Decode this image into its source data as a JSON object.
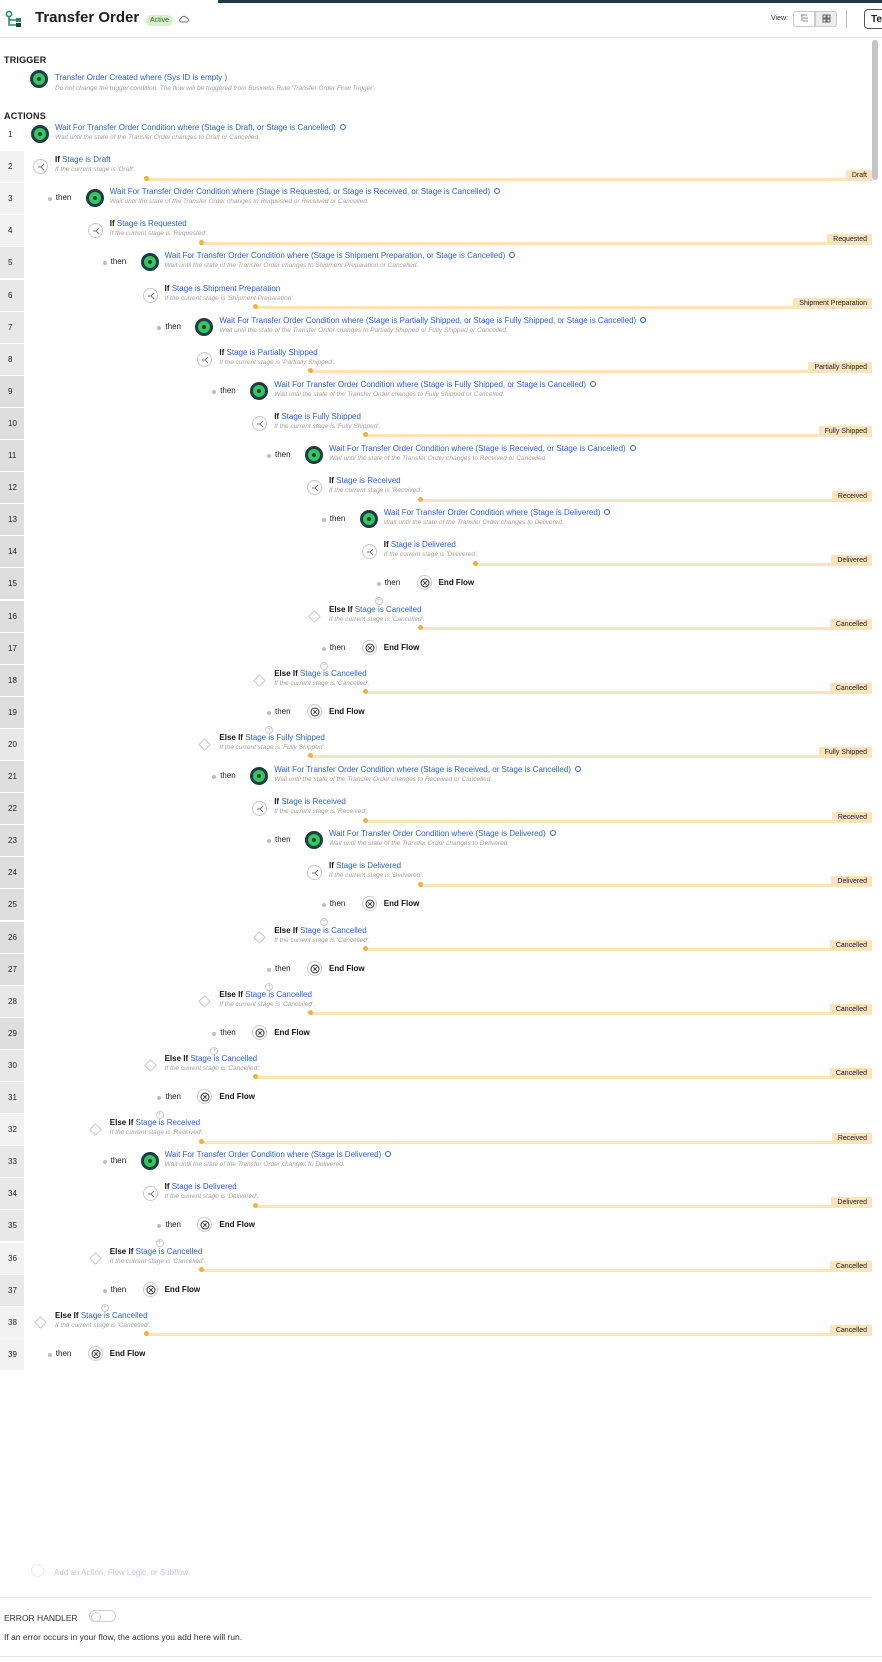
{
  "header": {
    "title": "Transfer Order",
    "status_badge": "Active",
    "view_label": "View:",
    "test_button": "Te",
    "cloud_icon": "cloud-sync-icon",
    "view_icons": [
      "tree-view-icon",
      "grid-view-icon"
    ]
  },
  "trigger": {
    "section_label": "TRIGGER",
    "title": "Transfer Order Created where (Sys ID is empty )",
    "description": "Do not change the trigger condition. The flow will be triggered from Business Rule 'Transfer Order Flow Trigger'."
  },
  "actions_label": "ACTIONS",
  "rows": [
    {
      "num": "1",
      "kind": "wait",
      "depth": 0,
      "title": "Wait For Transfer Order Condition where (Stage is Draft, or Stage is Cancelled)",
      "sub": "Wait until the state of the Transfer Order changes to Draft or Cancelled."
    },
    {
      "num": "2",
      "kind": "if",
      "depth": 0,
      "keyword": "If",
      "title": "Stage is Draft",
      "sub": "If the current stage is 'Draft'.",
      "tag": "Draft"
    },
    {
      "num": "3",
      "kind": "wait",
      "depth": 1,
      "then": "then",
      "title": "Wait For Transfer Order Condition where (Stage is Requested, or Stage is Received, or Stage is Cancelled)",
      "sub": "Wait until the state of the Transfer Order changes to Requested or Received or Cancelled."
    },
    {
      "num": "4",
      "kind": "if",
      "depth": 1,
      "keyword": "If",
      "title": "Stage is Requested",
      "sub": "If the current stage is 'Requested'.",
      "tag": "Requested"
    },
    {
      "num": "5",
      "kind": "wait",
      "depth": 2,
      "then": "then",
      "title": "Wait For Transfer Order Condition where (Stage is Shipment Preparation, or Stage is Cancelled)",
      "sub": "Wait until the state of the Transfer Order changes to Shipment Preparation or Cancelled."
    },
    {
      "num": "6",
      "kind": "if",
      "depth": 2,
      "keyword": "If",
      "title": "Stage is Shipment Preparation",
      "sub": "If the current stage is 'Shipment Preparation'.",
      "tag": "Shipment Preparation"
    },
    {
      "num": "7",
      "kind": "wait",
      "depth": 3,
      "then": "then",
      "title": "Wait For Transfer Order Condition where (Stage is Partially Shipped, or Stage is Fully Shipped, or Stage is Cancelled)",
      "sub": "Wait until the state of the Transfer Order changes to Partially Shipped or Fully Shipped or Cancelled."
    },
    {
      "num": "8",
      "kind": "if",
      "depth": 3,
      "keyword": "If",
      "title": "Stage is Partially Shipped",
      "sub": "If the current stage is 'Partially Shipped'.",
      "tag": "Partially Shipped"
    },
    {
      "num": "9",
      "kind": "wait",
      "depth": 4,
      "then": "then",
      "title": "Wait For Transfer Order Condition where (Stage is Fully Shipped, or Stage is Cancelled)",
      "sub": "Wait until the state of the Transfer Order changes to Fully Shipped or Cancelled."
    },
    {
      "num": "10",
      "kind": "if",
      "depth": 4,
      "keyword": "If",
      "title": "Stage is Fully Shipped",
      "sub": "If the current stage is 'Fully Shipped'.",
      "tag": "Fully Shipped"
    },
    {
      "num": "11",
      "kind": "wait",
      "depth": 5,
      "then": "then",
      "title": "Wait For Transfer Order Condition where (Stage is Received, or Stage is Cancelled)",
      "sub": "Wait until the state of the Transfer Order changes to Received or Cancelled."
    },
    {
      "num": "12",
      "kind": "if",
      "depth": 5,
      "keyword": "If",
      "title": "Stage is Received",
      "sub": "If the current stage is 'Received'.",
      "tag": "Received"
    },
    {
      "num": "13",
      "kind": "wait",
      "depth": 6,
      "then": "then",
      "title": "Wait For Transfer Order Condition where (Stage is Delivered)",
      "sub": "Wait until the state of the Transfer Order changes to Delivered."
    },
    {
      "num": "14",
      "kind": "if",
      "depth": 6,
      "keyword": "If",
      "title": "Stage is Delivered",
      "sub": "If the current stage is 'Delivered'.",
      "tag": "Delivered"
    },
    {
      "num": "15",
      "kind": "end",
      "depth": 7,
      "then": "then",
      "title": "End Flow",
      "plus": 6
    },
    {
      "num": "16",
      "kind": "elseif",
      "depth": 5,
      "keyword": "Else If",
      "title": "Stage is Cancelled",
      "sub": "If the current stage is 'Cancelled'.",
      "tag": "Cancelled"
    },
    {
      "num": "17",
      "kind": "end",
      "depth": 6,
      "then": "then",
      "title": "End Flow",
      "plus": 5
    },
    {
      "num": "18",
      "kind": "elseif",
      "depth": 4,
      "keyword": "Else If",
      "title": "Stage is Cancelled",
      "sub": "If the current stage is 'Cancelled'.",
      "tag": "Cancelled"
    },
    {
      "num": "19",
      "kind": "end",
      "depth": 5,
      "then": "then",
      "title": "End Flow",
      "plus": 4
    },
    {
      "num": "20",
      "kind": "elseif",
      "depth": 3,
      "keyword": "Else If",
      "title": "Stage is Fully Shipped",
      "sub": "If the current stage is 'Fully Shipped'.",
      "tag": "Fully Shipped"
    },
    {
      "num": "21",
      "kind": "wait",
      "depth": 4,
      "then": "then",
      "title": "Wait For Transfer Order Condition where (Stage is Received, or Stage is Cancelled)",
      "sub": "Wait until the state of the Transfer Order changes to Received or Cancelled."
    },
    {
      "num": "22",
      "kind": "if",
      "depth": 4,
      "keyword": "If",
      "title": "Stage is Received",
      "sub": "If the current stage is 'Received'.",
      "tag": "Received"
    },
    {
      "num": "23",
      "kind": "wait",
      "depth": 5,
      "then": "then",
      "title": "Wait For Transfer Order Condition where (Stage is Delivered)",
      "sub": "Wait until the state of the Transfer Order changes to Delivered."
    },
    {
      "num": "24",
      "kind": "if",
      "depth": 5,
      "keyword": "If",
      "title": "Stage is Delivered",
      "sub": "If the current stage is 'Delivered'.",
      "tag": "Delivered"
    },
    {
      "num": "25",
      "kind": "end",
      "depth": 6,
      "then": "then",
      "title": "End Flow",
      "plus": 5
    },
    {
      "num": "26",
      "kind": "elseif",
      "depth": 4,
      "keyword": "Else If",
      "title": "Stage is Cancelled",
      "sub": "If the current stage is 'Cancelled'.",
      "tag": "Cancelled"
    },
    {
      "num": "27",
      "kind": "end",
      "depth": 5,
      "then": "then",
      "title": "End Flow",
      "plus": 4
    },
    {
      "num": "28",
      "kind": "elseif",
      "depth": 3,
      "keyword": "Else If",
      "title": "Stage is Cancelled",
      "sub": "If the current stage is 'Cancelled'.",
      "tag": "Cancelled"
    },
    {
      "num": "29",
      "kind": "end",
      "depth": 4,
      "then": "then",
      "title": "End Flow",
      "plus": 3
    },
    {
      "num": "30",
      "kind": "elseif",
      "depth": 2,
      "keyword": "Else If",
      "title": "Stage is Cancelled",
      "sub": "If the current stage is 'Cancelled'.",
      "tag": "Cancelled"
    },
    {
      "num": "31",
      "kind": "end",
      "depth": 3,
      "then": "then",
      "title": "End Flow",
      "plus": 2
    },
    {
      "num": "32",
      "kind": "elseif",
      "depth": 1,
      "keyword": "Else If",
      "title": "Stage is Received",
      "sub": "If the current stage is 'Received'.",
      "tag": "Received"
    },
    {
      "num": "33",
      "kind": "wait",
      "depth": 2,
      "then": "then",
      "title": "Wait For Transfer Order Condition where (Stage is Delivered)",
      "sub": "Wait until the state of the Transfer Order changes to Delivered."
    },
    {
      "num": "34",
      "kind": "if",
      "depth": 2,
      "keyword": "If",
      "title": "Stage is Delivered",
      "sub": "If the current stage is 'Delivered'.",
      "tag": "Delivered"
    },
    {
      "num": "35",
      "kind": "end",
      "depth": 3,
      "then": "then",
      "title": "End Flow",
      "plus": 2
    },
    {
      "num": "36",
      "kind": "elseif",
      "depth": 1,
      "keyword": "Else If",
      "title": "Stage is Cancelled",
      "sub": "If the current stage is 'Cancelled'.",
      "tag": "Cancelled"
    },
    {
      "num": "37",
      "kind": "end",
      "depth": 2,
      "then": "then",
      "title": "End Flow",
      "plus": 1
    },
    {
      "num": "38",
      "kind": "elseif",
      "depth": 0,
      "keyword": "Else If",
      "title": "Stage is Cancelled",
      "sub": "If the current stage is 'Cancelled'.",
      "tag": "Cancelled"
    },
    {
      "num": "39",
      "kind": "end",
      "depth": 1,
      "then": "then",
      "title": "End Flow"
    }
  ],
  "add_action": "Add an Action, Flow Logic, or Subflow",
  "error_handler": {
    "label": "ERROR HANDLER",
    "description": "If an error occurs in your flow, the actions you add here will run."
  },
  "colors": {
    "link": "#2b5fd9",
    "node_green": "#30c95a",
    "node_dark": "#1f3b47",
    "branch_bar": "#fbe3be",
    "branch_dot": "#f2b03c",
    "active_badge": "#d8eecd"
  }
}
